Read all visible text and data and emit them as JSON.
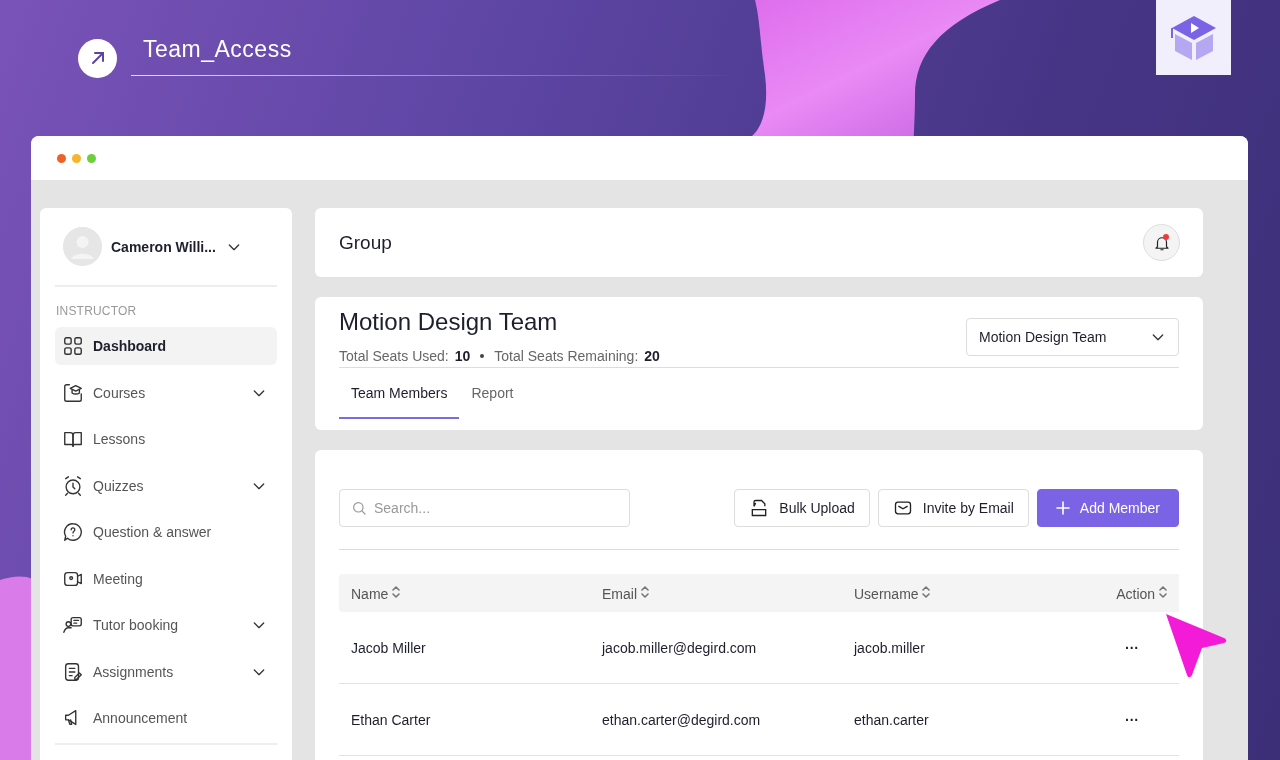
{
  "header": {
    "title": "Team_Access"
  },
  "sidebar": {
    "user": {
      "name": "Cameron Willi..."
    },
    "section": "INSTRUCTOR",
    "items": [
      {
        "label": "Dashboard",
        "selected": true,
        "expandable": false
      },
      {
        "label": "Courses",
        "selected": false,
        "expandable": true
      },
      {
        "label": "Lessons",
        "selected": false,
        "expandable": false
      },
      {
        "label": "Quizzes",
        "selected": false,
        "expandable": true
      },
      {
        "label": "Question & answer",
        "selected": false,
        "expandable": false
      },
      {
        "label": "Meeting",
        "selected": false,
        "expandable": false
      },
      {
        "label": "Tutor booking",
        "selected": false,
        "expandable": true
      },
      {
        "label": "Assignments",
        "selected": false,
        "expandable": true
      },
      {
        "label": "Announcement",
        "selected": false,
        "expandable": false
      }
    ]
  },
  "topbar": {
    "title": "Group",
    "notification": true
  },
  "team": {
    "title": "Motion Design Team",
    "stats": [
      {
        "label": "Total Seats Used:",
        "value": "10"
      },
      {
        "label": "Total Seats Remaining:",
        "value": "20"
      }
    ],
    "select": {
      "value": "Motion Design Team"
    },
    "tabs": [
      {
        "label": "Team Members",
        "selected": true
      },
      {
        "label": "Report",
        "selected": false
      }
    ]
  },
  "members": {
    "search": {
      "placeholder": "Search..."
    },
    "buttons": [
      {
        "label": "Bulk Upload",
        "kind": "csv"
      },
      {
        "label": "Invite by Email",
        "kind": "email"
      },
      {
        "label": "Add Member",
        "kind": "add"
      }
    ],
    "columns": [
      "Name",
      "Email",
      "Username",
      "Action"
    ],
    "rows": [
      {
        "name": "Jacob Miller",
        "email": "jacob.miller@degird.com",
        "username": "jacob.miller",
        "action": "···"
      },
      {
        "name": "Ethan Carter",
        "email": "ethan.carter@degird.com",
        "username": "ethan.carter",
        "action": "···"
      }
    ]
  }
}
